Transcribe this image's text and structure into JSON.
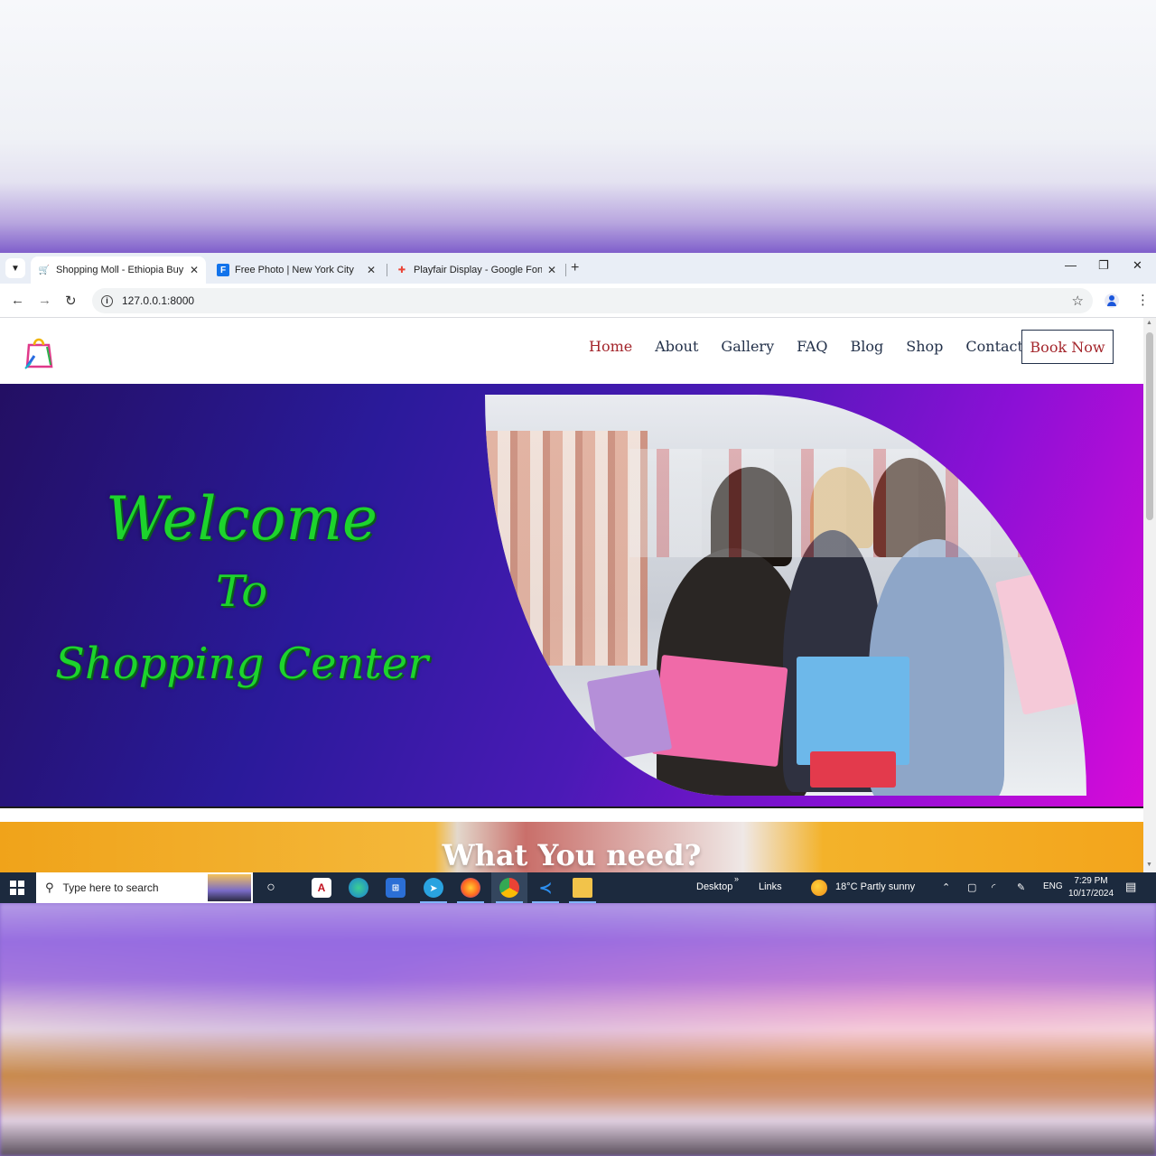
{
  "browser": {
    "tabs": [
      {
        "title": "Shopping Moll - Ethiopia Buy &",
        "icon": "cart-icon",
        "active": true
      },
      {
        "title": "Free Photo | New York City",
        "icon": "freepik-icon",
        "active": false
      },
      {
        "title": "Playfair Display - Google Fonts",
        "icon": "google-fonts-icon",
        "active": false
      }
    ],
    "url": "127.0.0.1:8000"
  },
  "site": {
    "nav": [
      "Home",
      "About",
      "Gallery",
      "FAQ",
      "Blog",
      "Shop",
      "Contact"
    ],
    "active_nav": "Home",
    "book_button": "Book Now",
    "hero": {
      "line1": "Welcome",
      "line2": "To",
      "line3": "Shopping Center"
    },
    "section_title": "What You need?"
  },
  "taskbar": {
    "search_placeholder": "Type here to search",
    "desktop_label": "Desktop",
    "links_label": "Links",
    "weather": "18°C  Partly sunny",
    "language": "ENG",
    "time": "7:29 PM",
    "date": "10/17/2024"
  },
  "colors": {
    "accent_red": "#a4262c",
    "nav_text": "#23314a",
    "welcome_green": "#1dd42d",
    "taskbar": "#1c2a3e"
  }
}
